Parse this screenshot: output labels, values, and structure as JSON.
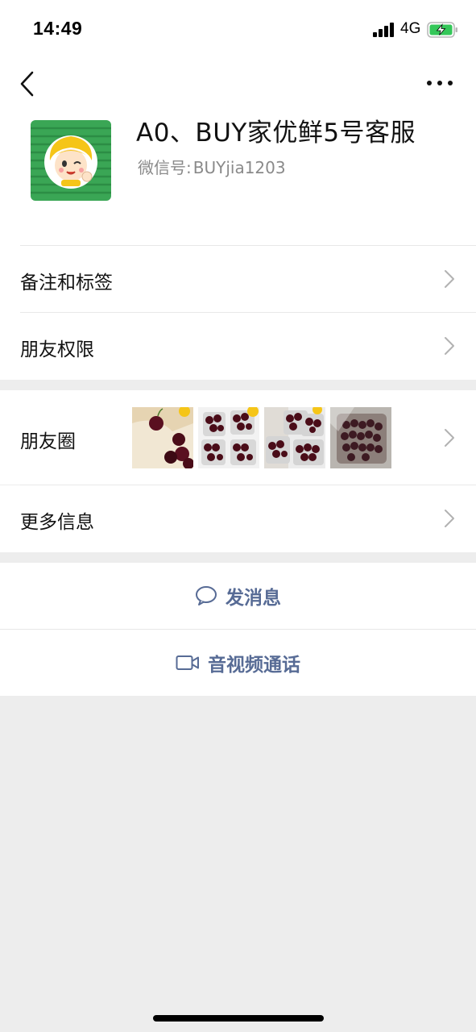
{
  "status_bar": {
    "time": "14:49",
    "network": "4G",
    "icons": [
      "signal-icon",
      "battery-charging-icon"
    ]
  },
  "nav": {
    "back_icon": "chevron-left-icon",
    "more_icon": "more-dots-icon"
  },
  "profile": {
    "nickname": "A0、BUY家优鲜5号客服",
    "wechat_id_label": "微信号:",
    "wechat_id": "BUYjia1203"
  },
  "rows": {
    "remark_tags": "备注和标签",
    "friend_permissions": "朋友权限",
    "moments": "朋友圈",
    "more_info": "更多信息"
  },
  "moments_thumbnails": [
    "cherry-photo-1",
    "cherry-photo-2",
    "cherry-photo-3",
    "cherry-photo-4"
  ],
  "actions": {
    "message": "发消息",
    "video_call": "音视频通话"
  },
  "colors": {
    "link_blue": "#576b95",
    "background_gray": "#ededed",
    "avatar_green": "#3aa655",
    "battery_green": "#34c759"
  }
}
